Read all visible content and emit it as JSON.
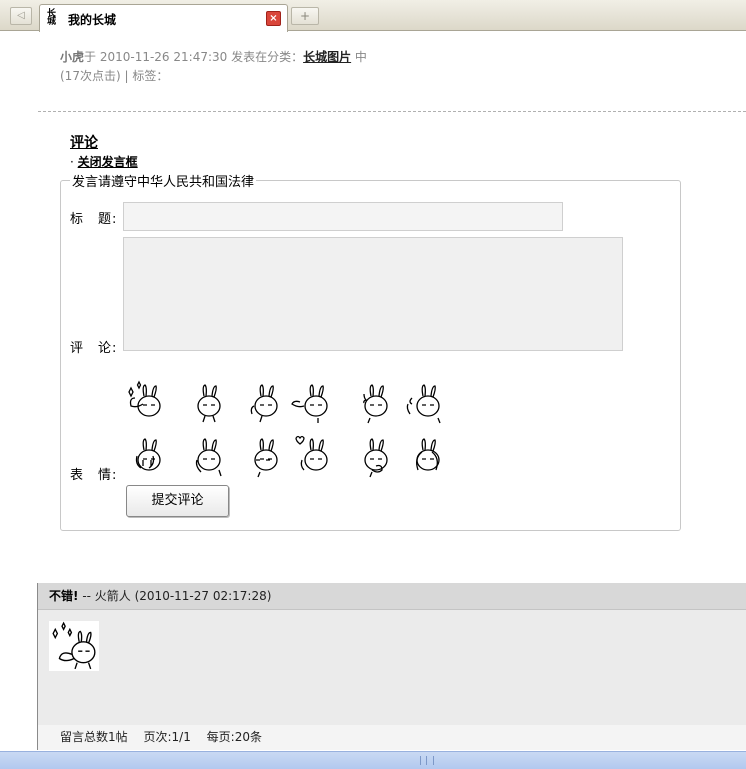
{
  "browser": {
    "favicon_text": "长城",
    "tab_title": "我的长城",
    "close_symbol": "×",
    "new_tab_symbol": "+",
    "nav_symbol": "◁"
  },
  "post_meta": {
    "author": "小虎",
    "posted_prefix": "于 2010-11-26 21:47:30 发表在分类：",
    "category_link": "长城图片",
    "category_suffix": " 中",
    "clicks": "(17次点击)",
    "tags_label": " | 标签："
  },
  "comment_form": {
    "heading": "评论",
    "close_link_prefix": "· ",
    "close_link": "关闭发言框",
    "legend": "发言请遵守中华人民共和国法律",
    "title_label": "标　题:",
    "comment_label": "评　论:",
    "emoji_label": "表　情:",
    "title_value": "",
    "comment_value": "",
    "submit_label": "提交评论",
    "emojis": [
      "sparkle-bunny-emoji",
      "plain-bunny-emoji",
      "side-bunny-emoji",
      "pointing-bunny-emoji",
      "sweat-bunny-emoji",
      "turning-bunny-emoji",
      "crying-bunny-emoji",
      "back-bunny-emoji",
      "shy-bunny-emoji",
      "heart-bunny-emoji",
      "thinking-bunny-emoji",
      "hug-bunny-emoji"
    ]
  },
  "comments": [
    {
      "title": "不错!",
      "author_line": "-- 火箭人 (2010-11-27 02:17:28)",
      "emoji": "sparkle-bunny-emoji"
    }
  ],
  "footer": {
    "total": "留言总数1帖",
    "page": "页次:1/1",
    "per_page": "每页:20条"
  }
}
